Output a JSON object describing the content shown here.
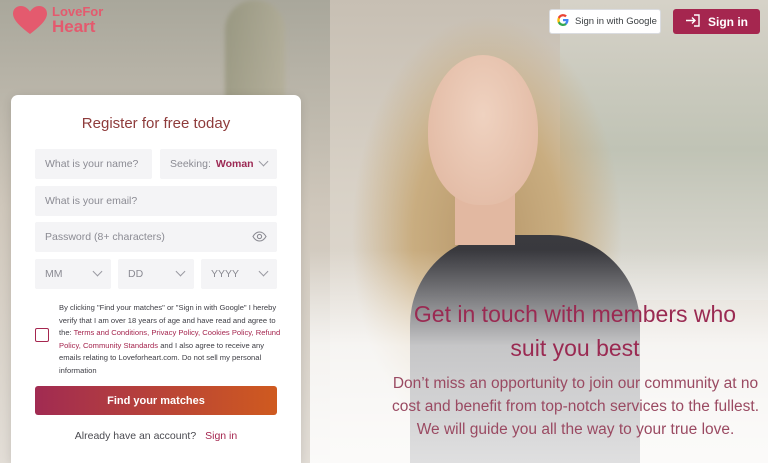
{
  "brand": {
    "name_line1": "LoveFor",
    "name_line2": "Heart",
    "color": "#e45a6e"
  },
  "header": {
    "google_label": "Sign in with Google",
    "signin_label": "Sign in",
    "signin_color": "#a5264f"
  },
  "form": {
    "title": "Register for free today",
    "name_placeholder": "What is your name?",
    "seeking_label": "Seeking:",
    "seeking_value": "Woman",
    "email_placeholder": "What is your email?",
    "password_placeholder": "Password (8+ characters)",
    "month_placeholder": "MM",
    "day_placeholder": "DD",
    "year_placeholder": "YYYY",
    "terms": {
      "part1": "By clicking \"Find your matches\" or \"Sign in with Google\" I hereby verify that I am over 18 years of age and have read and agree to the:",
      "link_terms": "Terms and Conditions,",
      "link_privacy": "Privacy Policy,",
      "link_cookies": "Cookies Policy,",
      "link_refund": "Refund Policy,",
      "link_community": "Community Standards",
      "part2": "and I also agree to receive any emails relating to Loveforheart.com. Do not sell my personal information"
    },
    "submit_label": "Find your matches",
    "already_text": "Already have an account?",
    "already_link": "Sign in"
  },
  "hero": {
    "title": "Get in touch with members who suit you best",
    "subtitle": "Don’t miss an opportunity to join our community at no cost and benefit from top-notch services to the fullest. We will guide you all the way to your true love."
  },
  "icons": {
    "logo": "heart-icon",
    "google": "google-icon",
    "signin": "signin-arrow-icon",
    "password": "eye-icon"
  }
}
